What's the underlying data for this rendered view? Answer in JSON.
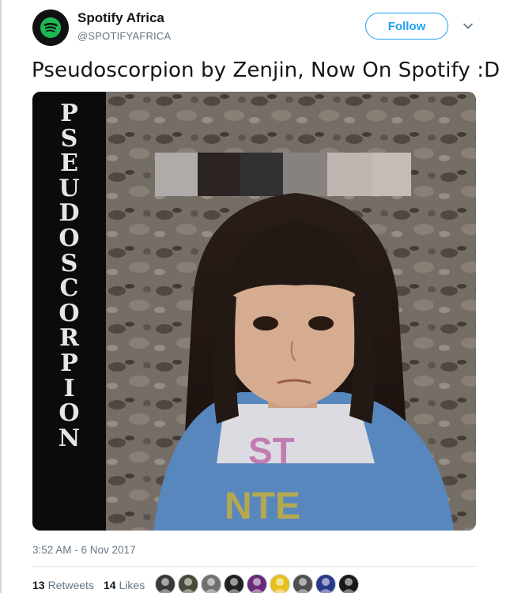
{
  "account": {
    "display_name": "Spotify Africa",
    "handle": "@SPOTIFYAFRICA",
    "avatar_icon": "spotify-logo-icon",
    "brand_color": "#1db954"
  },
  "follow_label": "Follow",
  "caret_icon": "chevron-down-icon",
  "tweet": {
    "text": "Pseudoscorpion by Zenjin, Now On Spotify :D",
    "media": {
      "title_letters": [
        "P",
        "S",
        "E",
        "U",
        "D",
        "O",
        "S",
        "C",
        "O",
        "R",
        "P",
        "I",
        "O",
        "N"
      ]
    },
    "timestamp": "3:52 AM - 6 Nov 2017"
  },
  "stats": {
    "retweets_count": "13",
    "retweets_label": "Retweets",
    "likes_count": "14",
    "likes_label": "Likes"
  },
  "likers": [
    {
      "icon": "avatar-icon",
      "color": "#3a3a3a"
    },
    {
      "icon": "avatar-icon",
      "color": "#4a4a3a"
    },
    {
      "icon": "avatar-icon",
      "color": "#707070"
    },
    {
      "icon": "avatar-icon",
      "color": "#222222"
    },
    {
      "icon": "avatar-icon",
      "color": "#6a2a7a"
    },
    {
      "icon": "avatar-icon",
      "color": "#e8c020"
    },
    {
      "icon": "avatar-icon",
      "color": "#505050"
    },
    {
      "icon": "avatar-icon",
      "color": "#2a3a8a"
    },
    {
      "icon": "avatar-icon",
      "color": "#1a1a1a"
    }
  ],
  "accent": "#1da1f2",
  "secondary_text": "#657786"
}
